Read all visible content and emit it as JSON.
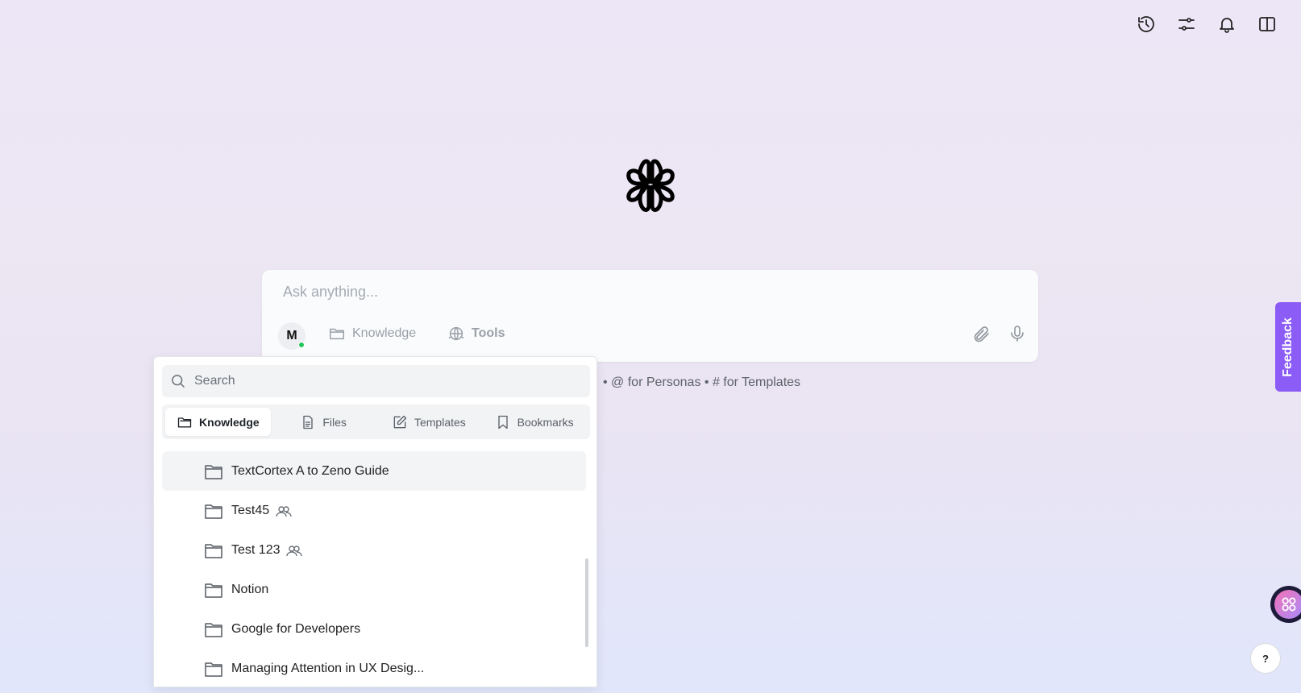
{
  "header": {
    "icons": [
      "history-icon",
      "sliders-icon",
      "bell-icon",
      "split-panel-icon"
    ]
  },
  "composer": {
    "placeholder": "Ask anything...",
    "avatar_letter": "M",
    "knowledge_label": "Knowledge",
    "tools_label": "Tools",
    "hint": "• @ for Personas • # for Templates"
  },
  "dropdown": {
    "search_placeholder": "Search",
    "tabs": [
      {
        "label": "Knowledge",
        "active": true,
        "icon": "folder-icon"
      },
      {
        "label": "Files",
        "active": false,
        "icon": "file-icon"
      },
      {
        "label": "Templates",
        "active": false,
        "icon": "edit-icon"
      },
      {
        "label": "Bookmarks",
        "active": false,
        "icon": "bookmark-icon"
      }
    ],
    "items": [
      {
        "label": "TextCortex A to Zeno Guide",
        "shared": false
      },
      {
        "label": "Test45",
        "shared": true
      },
      {
        "label": "Test 123",
        "shared": true
      },
      {
        "label": "Notion",
        "shared": false
      },
      {
        "label": "Google for Developers",
        "shared": false
      },
      {
        "label": "Managing Attention in UX Desig...",
        "shared": false
      }
    ]
  },
  "feedback_label": "Feedback",
  "help_label": "?"
}
